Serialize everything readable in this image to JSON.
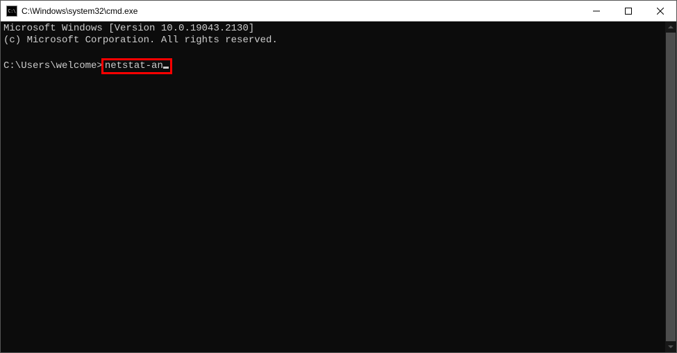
{
  "titlebar": {
    "icon_label": "C:\\",
    "title": "C:\\Windows\\system32\\cmd.exe"
  },
  "terminal": {
    "line1": "Microsoft Windows [Version 10.0.19043.2130]",
    "line2": "(c) Microsoft Corporation. All rights reserved.",
    "prompt": "C:\\Users\\welcome>",
    "command": "netstat-an"
  }
}
